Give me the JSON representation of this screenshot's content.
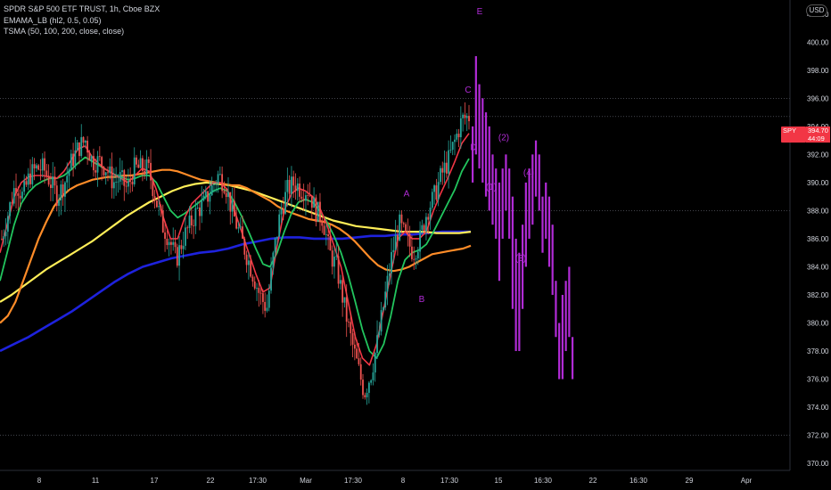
{
  "legend": {
    "title": "SPDR S&P 500 ETF TRUST, 1h, Cboe BZX",
    "indicator1": "EMAMA_LB (hl2, 0.5, 0.05)",
    "indicator2": "TSMA (50, 100, 200, close, close)"
  },
  "currency_label": "USD",
  "last_price": {
    "symbol": "SPY",
    "value": "394.70",
    "countdown": "44:09",
    "color": "#f23645"
  },
  "colors": {
    "background": "#000000",
    "bull_candle": "#26a69a",
    "bear_candle": "#ef5350",
    "projection": "#b12bd6",
    "ema_fast": "#f23645",
    "ema_slow": "#22c55e",
    "sma50": "#ff8c28",
    "sma100": "#ffee58",
    "sma200": "#1e22dd"
  },
  "chart_data": {
    "type": "candlestick",
    "symbol": "SPY",
    "interval": "1h",
    "ylim": [
      369.5,
      403
    ],
    "y_ticks": [
      "370.00",
      "372.00",
      "374.00",
      "376.00",
      "378.00",
      "380.00",
      "382.00",
      "384.00",
      "386.00",
      "388.00",
      "390.00",
      "392.00",
      "394.00",
      "396.00",
      "398.00",
      "400.00",
      "402.00"
    ],
    "x_ticks": [
      "8",
      "11",
      "17",
      "22",
      "17:30",
      "Mar",
      "17:30",
      "8",
      "17:30",
      "15",
      "16:30",
      "22",
      "16:30",
      "29",
      "Apr"
    ],
    "horizontal_levels": [
      396,
      394.7,
      388,
      372
    ],
    "wave_labels": [
      "A",
      "B",
      "C",
      "D",
      "E",
      "(1)",
      "(2)",
      "(3)",
      "(4)"
    ],
    "price_path": [
      386,
      388,
      390,
      389,
      390.5,
      391,
      391,
      390,
      389,
      390,
      391.5,
      392.5,
      393,
      391.5,
      391.5,
      391,
      390,
      390.3,
      389.5,
      391,
      391,
      391,
      389,
      387,
      386,
      384.5,
      386,
      387,
      388,
      388.5,
      389.5,
      390.5,
      390,
      388,
      386.5,
      385,
      383.5,
      382,
      381,
      385,
      388,
      389.5,
      390,
      389.5,
      389.5,
      388,
      387.5,
      385,
      384,
      381.5,
      379,
      377,
      375,
      376.5,
      379,
      382,
      385,
      387,
      386,
      385,
      386,
      388,
      389,
      390.5,
      391.5,
      393,
      394.5,
      394.7
    ],
    "ema_fast": [
      385,
      387,
      389,
      390,
      390.4,
      390.5,
      390.5,
      390.4,
      390.3,
      390.8,
      391.6,
      392.4,
      392.6,
      391.8,
      391.3,
      390.9,
      390.6,
      390.3,
      390,
      390.5,
      391,
      390.8,
      389.5,
      387.5,
      386,
      386,
      387.5,
      388.5,
      389,
      389.5,
      390,
      390,
      389.5,
      388,
      386.5,
      385,
      383.5,
      382.2,
      382.5,
      385.5,
      388,
      389.2,
      389.6,
      389.4,
      389,
      388.2,
      387,
      385.5,
      384,
      381.5,
      379,
      377.5,
      377,
      378.5,
      381,
      383.5,
      386,
      386.5,
      386,
      386,
      386.5,
      388,
      389.2,
      390.3,
      391.5,
      392.8,
      393.5
    ],
    "ema_slow": [
      383,
      385,
      387,
      388.5,
      389.3,
      389.8,
      390.1,
      390.3,
      390.3,
      390.5,
      390.9,
      391.4,
      391.8,
      391.5,
      391.2,
      390.9,
      390.6,
      390.4,
      390.2,
      390.3,
      390.5,
      390.5,
      390,
      389,
      388,
      387.5,
      387.8,
      388.2,
      388.6,
      389,
      389.4,
      389.6,
      389.4,
      388.6,
      387.6,
      386.5,
      385.3,
      384.2,
      384,
      385,
      386.5,
      387.8,
      388.6,
      388.8,
      388.6,
      388,
      387.2,
      386.2,
      385,
      383.4,
      381.5,
      379.5,
      378,
      377.5,
      378.5,
      380.5,
      383,
      384.5,
      385,
      385.2,
      385.6,
      386.5,
      387.5,
      388.5,
      389.5,
      390.8,
      391.7
    ],
    "sma50": [
      380,
      380.5,
      381.5,
      383,
      384.5,
      386,
      387.2,
      388.3,
      389,
      389.5,
      389.8,
      390,
      390.2,
      390.3,
      390.4,
      390.4,
      390.5,
      390.5,
      390.6,
      390.7,
      390.8,
      390.9,
      390.9,
      390.8,
      390.6,
      390.4,
      390.2,
      390.1,
      390,
      389.9,
      389.8,
      389.8,
      389.6,
      389.3,
      389,
      388.7,
      388.3,
      388,
      387.8,
      387.6,
      387.4,
      387.3,
      387.2,
      387,
      386.7,
      386.3,
      385.8,
      385.2,
      384.6,
      384.1,
      383.8,
      383.7,
      383.8,
      384,
      384.3,
      384.6,
      384.9,
      385,
      385.1,
      385.2,
      385.3,
      385.5
    ],
    "sma100": [
      381.5,
      382,
      382.6,
      383.2,
      383.8,
      384.3,
      384.8,
      385.3,
      385.8,
      386.4,
      387,
      387.6,
      388.1,
      388.6,
      389,
      389.4,
      389.7,
      389.9,
      390,
      389.9,
      389.8,
      389.6,
      389.4,
      389.1,
      388.8,
      388.5,
      388.2,
      387.9,
      387.6,
      387.3,
      387.1,
      386.9,
      386.8,
      386.7,
      386.6,
      386.5,
      386.5,
      386.5,
      386.4,
      386.4,
      386.4,
      386.5
    ],
    "sma200": [
      378,
      378.5,
      379,
      379.6,
      380.2,
      380.8,
      381.5,
      382.2,
      382.9,
      383.5,
      384,
      384.3,
      384.6,
      384.8,
      385,
      385.1,
      385.3,
      385.6,
      385.8,
      386,
      386.1,
      386.1,
      386,
      386,
      386,
      386.1,
      386.2,
      386.2,
      386.3,
      386.3,
      386.4,
      386.5,
      386.5,
      386.5
    ],
    "projection_bars": [
      [
        390,
        394
      ],
      [
        392,
        399
      ],
      [
        391,
        397
      ],
      [
        390,
        396
      ],
      [
        389,
        395
      ],
      [
        388,
        394
      ],
      [
        387,
        392
      ],
      [
        386,
        391
      ],
      [
        383,
        390
      ],
      [
        386,
        391
      ],
      [
        388,
        392
      ],
      [
        386,
        391
      ],
      [
        381,
        389
      ],
      [
        378,
        386
      ],
      [
        378,
        385
      ],
      [
        381,
        387
      ],
      [
        384,
        390
      ],
      [
        386,
        391
      ],
      [
        387,
        392
      ],
      [
        389,
        393
      ],
      [
        388,
        392
      ],
      [
        385,
        389
      ],
      [
        386,
        390
      ],
      [
        384,
        389
      ],
      [
        382,
        387
      ],
      [
        379,
        383
      ],
      [
        376,
        380
      ],
      [
        376,
        382
      ],
      [
        378,
        383
      ],
      [
        379,
        384
      ],
      [
        376,
        379
      ]
    ]
  }
}
